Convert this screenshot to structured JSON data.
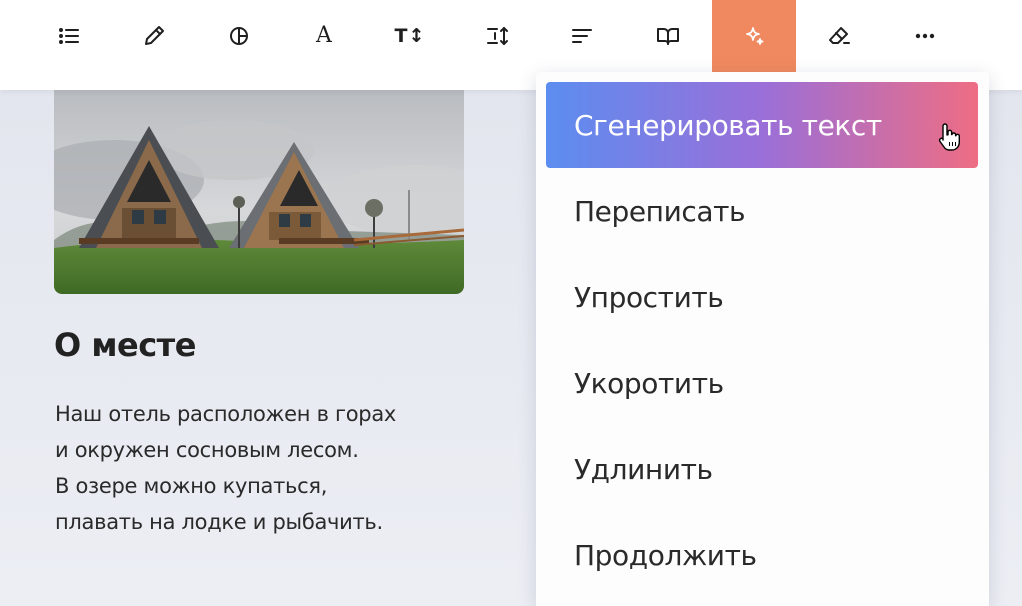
{
  "toolbar": {
    "tools": [
      {
        "icon": "list-icon",
        "active": false
      },
      {
        "icon": "eyedropper-icon",
        "active": false
      },
      {
        "icon": "half-circle-icon",
        "active": false
      },
      {
        "icon": "font-icon",
        "glyph": "A",
        "active": false
      },
      {
        "icon": "text-size-icon",
        "glyph": "T↕",
        "active": false
      },
      {
        "icon": "line-spacing-icon",
        "active": false
      },
      {
        "icon": "align-left-icon",
        "active": false
      },
      {
        "icon": "book-icon",
        "active": false
      },
      {
        "icon": "sparkle-ai-icon",
        "active": true
      },
      {
        "icon": "eraser-icon",
        "active": false
      },
      {
        "icon": "more-icon",
        "active": false
      }
    ],
    "active_color": "#f0895f"
  },
  "content": {
    "image_alt": "A-frame cabins on a grassy hillside",
    "heading": "О месте",
    "paragraph_lines": [
      "Наш отель расположен в горах",
      "и окружен сосновым лесом.",
      "В озере можно купаться,",
      "плавать на лодке и рыбачить."
    ]
  },
  "ai_menu": {
    "items": [
      {
        "label": "Сгенерировать текст",
        "highlighted": true
      },
      {
        "label": "Переписать",
        "highlighted": false
      },
      {
        "label": "Упростить",
        "highlighted": false
      },
      {
        "label": "Укоротить",
        "highlighted": false
      },
      {
        "label": "Удлинить",
        "highlighted": false
      },
      {
        "label": "Продолжить",
        "highlighted": false
      }
    ],
    "gradient_colors": [
      "#5c8df0",
      "#9a6fd8",
      "#ee6d84"
    ]
  }
}
